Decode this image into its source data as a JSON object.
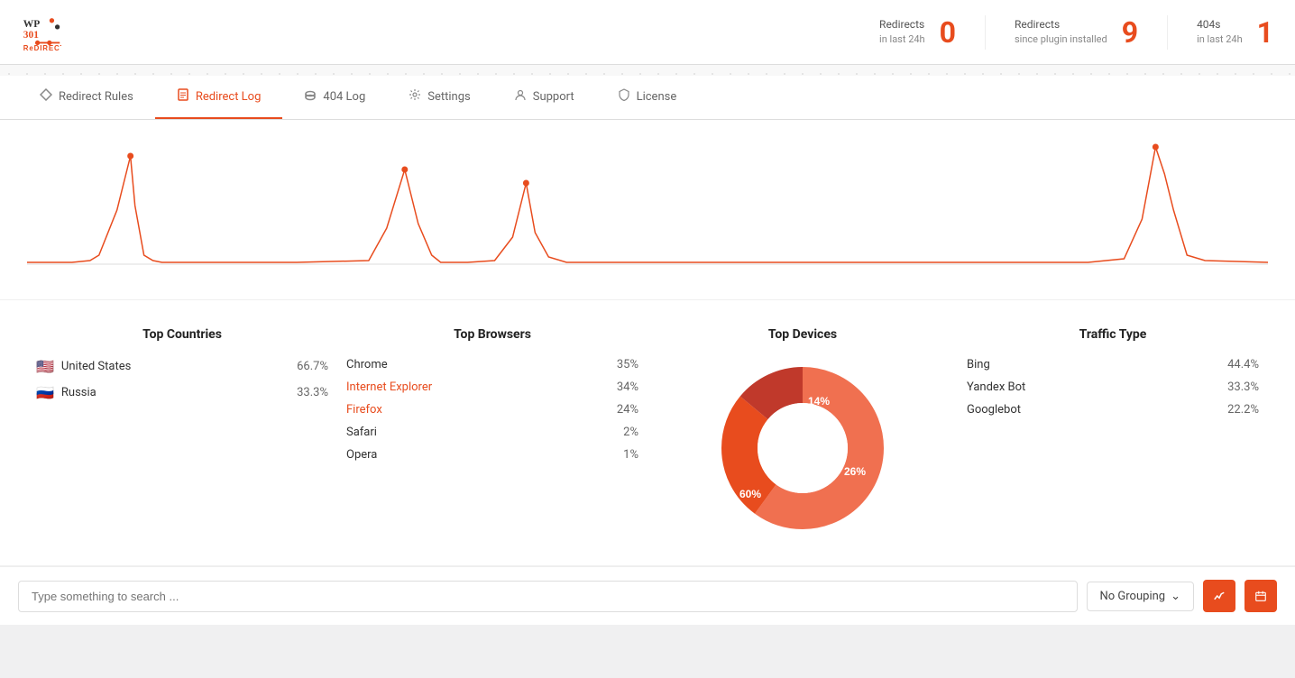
{
  "logo": {
    "wp": "WP",
    "num": "301",
    "redirects": "ReDIRECTS"
  },
  "header_stats": [
    {
      "key": "redirects_24h",
      "label": "Redirects",
      "sublabel": "in last 24h",
      "value": "0"
    },
    {
      "key": "redirects_total",
      "label": "Redirects",
      "sublabel": "since plugin installed",
      "value": "9"
    },
    {
      "key": "404s_24h",
      "label": "404s",
      "sublabel": "in last 24h",
      "value": "1"
    }
  ],
  "tabs": [
    {
      "key": "redirect-rules",
      "label": "Redirect Rules",
      "icon": "⬡",
      "active": false
    },
    {
      "key": "redirect-log",
      "label": "Redirect Log",
      "icon": "📄",
      "active": true
    },
    {
      "key": "404-log",
      "label": "404 Log",
      "icon": "🗄",
      "active": false
    },
    {
      "key": "settings",
      "label": "Settings",
      "icon": "⚙",
      "active": false
    },
    {
      "key": "support",
      "label": "Support",
      "icon": "👤",
      "active": false
    },
    {
      "key": "license",
      "label": "License",
      "icon": "🛡",
      "active": false
    }
  ],
  "top_countries": {
    "title": "Top Countries",
    "items": [
      {
        "name": "United States",
        "pct": "66.7%",
        "flag": "🇺🇸"
      },
      {
        "name": "Russia",
        "pct": "33.3%",
        "flag": "🇷🇺"
      }
    ]
  },
  "top_browsers": {
    "title": "Top Browsers",
    "items": [
      {
        "name": "Chrome",
        "pct": "35%"
      },
      {
        "name": "Internet Explorer",
        "pct": "34%"
      },
      {
        "name": "Firefox",
        "pct": "24%"
      },
      {
        "name": "Safari",
        "pct": "2%"
      },
      {
        "name": "Opera",
        "pct": "1%"
      }
    ]
  },
  "top_devices": {
    "title": "Top Devices",
    "segments": [
      {
        "pct": 60,
        "label": "60%",
        "color": "#f07050"
      },
      {
        "pct": 26,
        "label": "26%",
        "color": "#e84c1e"
      },
      {
        "pct": 14,
        "label": "14%",
        "color": "#c0392b"
      }
    ]
  },
  "traffic_type": {
    "title": "Traffic Type",
    "items": [
      {
        "name": "Bing",
        "pct": "44.4%"
      },
      {
        "name": "Yandex Bot",
        "pct": "33.3%"
      },
      {
        "name": "Googlebot",
        "pct": "22.2%"
      }
    ]
  },
  "search": {
    "placeholder": "Type something to search ...",
    "grouping_label": "No Grouping"
  }
}
